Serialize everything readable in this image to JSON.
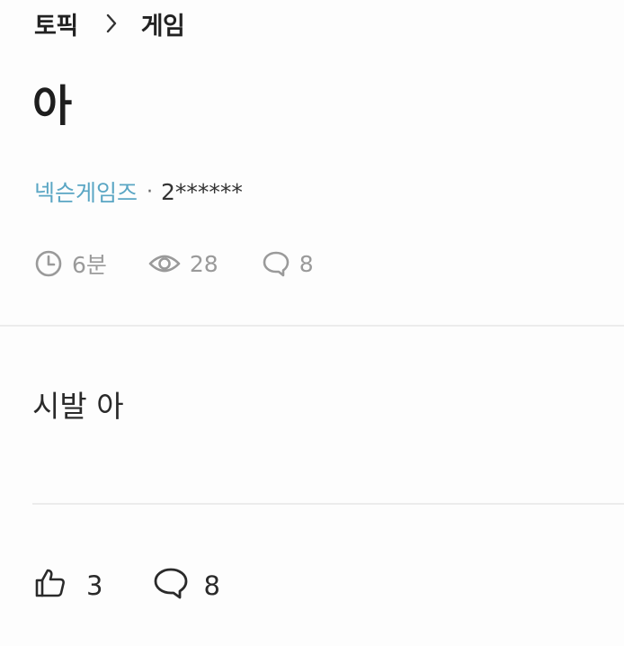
{
  "breadcrumb": {
    "root": "토픽",
    "current": "게임"
  },
  "post": {
    "title": "아",
    "author": "넥슨게임즈",
    "separator": "·",
    "masked_id": "2******",
    "body": "시발 아"
  },
  "stats": {
    "time_ago": "6분",
    "views": "28",
    "comments": "8"
  },
  "actions": {
    "likes": "3",
    "comments": "8"
  },
  "icons": {
    "breadcrumb_sep": "chevron-right-icon",
    "time": "clock-icon",
    "views": "eye-icon",
    "comments": "speech-bubble-icon",
    "like": "thumbs-up-icon"
  },
  "colors": {
    "author": "#5aa6c4",
    "muted": "#9a9a9a",
    "text": "#222222"
  }
}
